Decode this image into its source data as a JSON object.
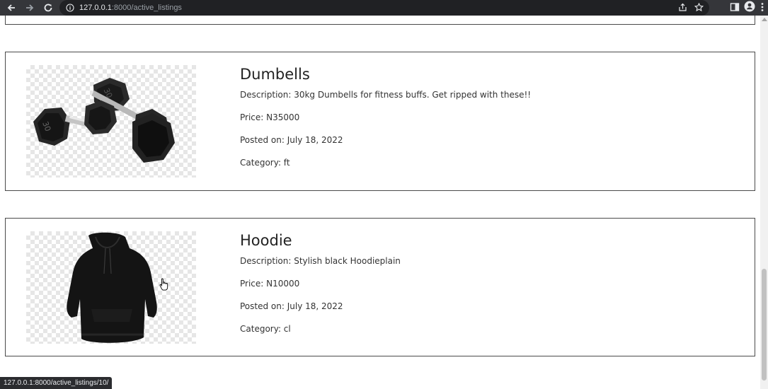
{
  "browser": {
    "url_host": "127.0.0.1",
    "url_rest": ":8000/active_listings",
    "status_url": "127.0.0.1:8000/active_listings/10/"
  },
  "icons": {
    "back": "arrow-left-icon",
    "forward": "arrow-right-icon",
    "reload": "reload-icon",
    "info": "info-icon",
    "share": "share-icon",
    "star": "star-icon",
    "sidepanel": "side-panel-icon",
    "profile": "profile-icon",
    "menu": "kebab-menu-icon",
    "cursor": "hand-pointer-icon"
  },
  "listings": [
    {
      "title": "Dumbells",
      "description": "Description: 30kg Dumbells for fitness buffs. Get ripped with these!!",
      "price": "Price: N35000",
      "posted": "Posted on: July 18, 2022",
      "category": "Category: ft",
      "image": "dumbbells-image"
    },
    {
      "title": "Hoodie",
      "description": "Description: Stylish black Hoodieplain",
      "price": "Price: N10000",
      "posted": "Posted on: July 18, 2022",
      "category": "Category: cl",
      "image": "hoodie-image"
    }
  ],
  "colors": {
    "toolbar": "#35363a",
    "omnibox": "#202124",
    "border": "#4a4a4a",
    "text": "#333333"
  }
}
